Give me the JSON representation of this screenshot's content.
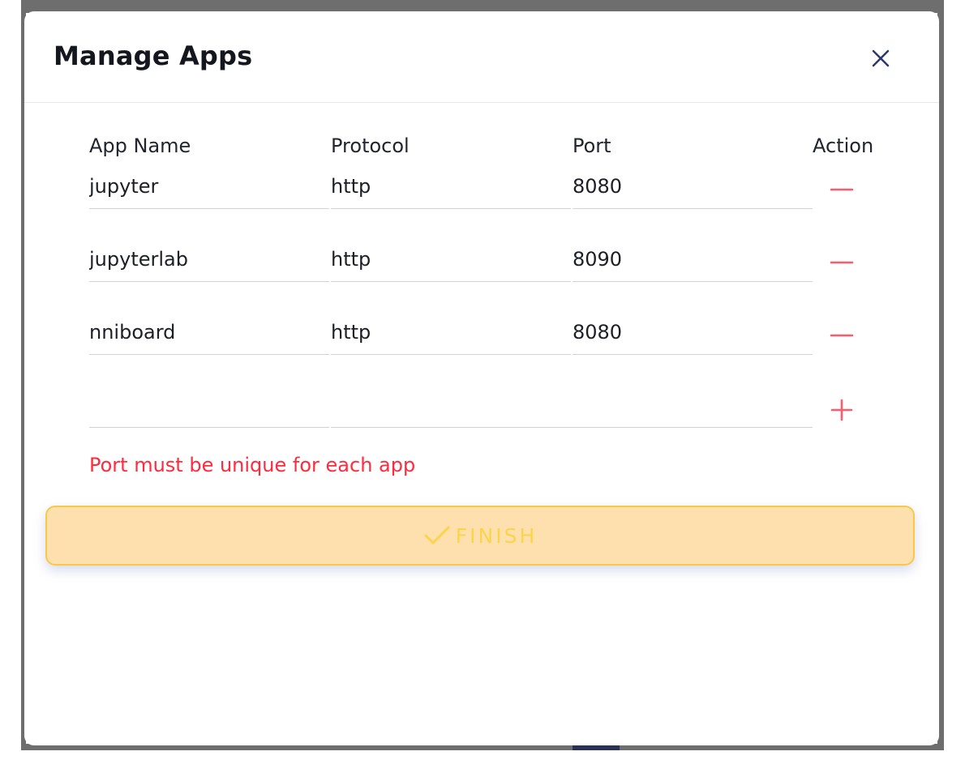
{
  "dialog": {
    "title": "Manage Apps",
    "close_icon": "close-icon"
  },
  "table": {
    "headers": {
      "app_name": "App Name",
      "protocol": "Protocol",
      "port": "Port",
      "action": "Action"
    },
    "rows": [
      {
        "app_name": "jupyter",
        "protocol": "http",
        "port": "8080",
        "action_icon": "minus-icon"
      },
      {
        "app_name": "jupyterlab",
        "protocol": "http",
        "port": "8090",
        "action_icon": "minus-icon"
      },
      {
        "app_name": "nniboard",
        "protocol": "http",
        "port": "8080",
        "action_icon": "minus-icon"
      }
    ],
    "new_row": {
      "app_name": "",
      "protocol_port": "",
      "action_icon": "plus-icon"
    }
  },
  "error_message": "Port must be unique for each app",
  "finish_button": {
    "label": "FINISH",
    "icon": "check-icon"
  },
  "colors": {
    "error": "#ff2a3d",
    "action_icon": "#ff5a6e",
    "finish_bg": "#fde0ae",
    "finish_border": "#f7c948",
    "finish_text": "#fbd44a",
    "close_icon": "#2f3b66"
  }
}
